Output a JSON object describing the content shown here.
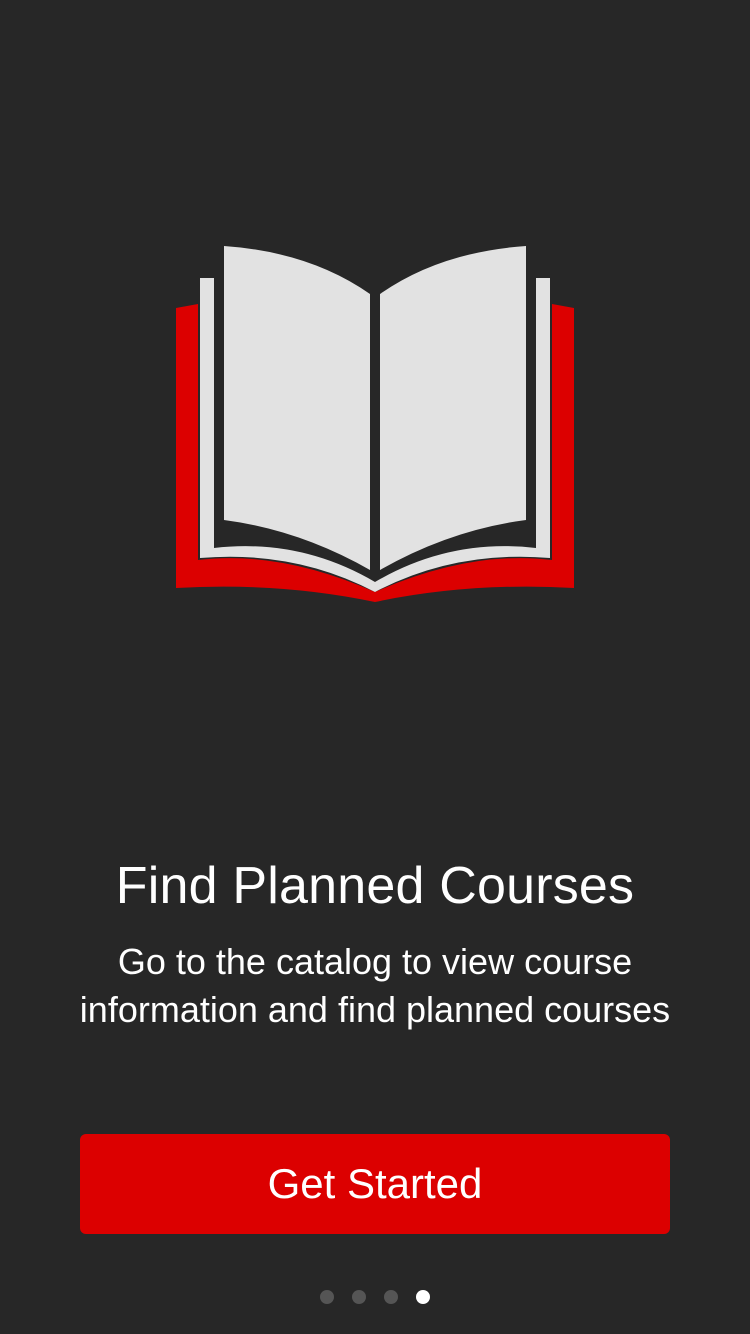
{
  "onboarding": {
    "illustration_icon": "open-book-icon",
    "title": "Find Planned Courses",
    "description_line1": "Go to the catalog to view course",
    "description_line2": "information and find planned courses",
    "cta_label": "Get Started",
    "pager": {
      "total": 4,
      "current": 4
    }
  },
  "colors": {
    "background": "#272727",
    "accent": "#dc0000",
    "page": "#e2e2e2",
    "text": "#ffffff"
  }
}
